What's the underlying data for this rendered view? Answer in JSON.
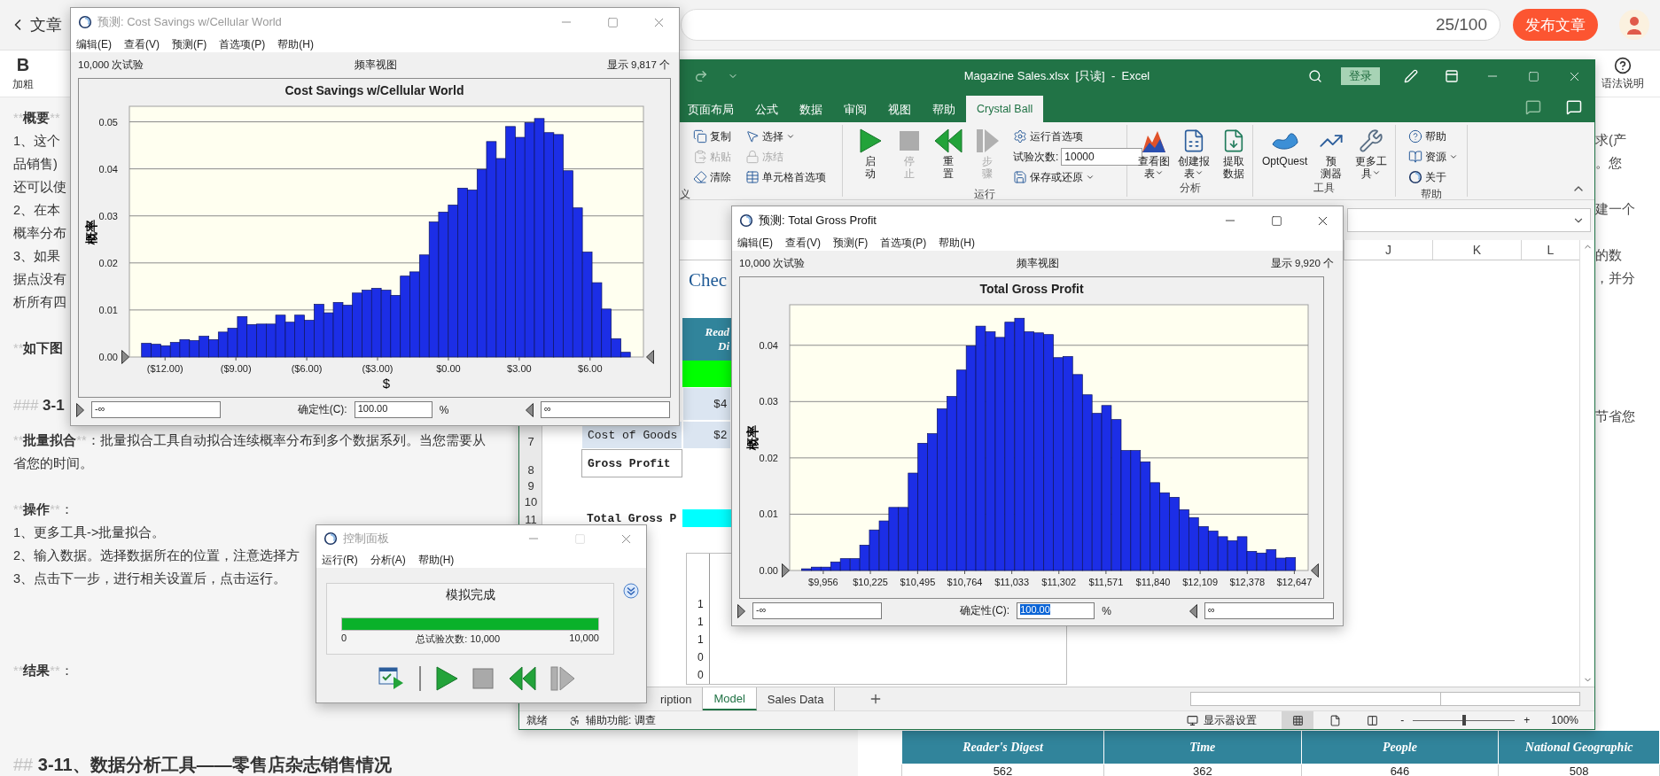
{
  "blog": {
    "back": "文章",
    "title_count": "25/100",
    "publish": "发布文章",
    "tools": [
      {
        "glyph": "B",
        "label": "加粗"
      }
    ],
    "help": "语法说明",
    "editor_lines": [
      {
        "kind": "text",
        "parts": [
          {
            "kind": "mark",
            "text": "**"
          },
          {
            "kind": "bold",
            "text": "概要"
          },
          {
            "kind": "mark",
            "text": "**"
          }
        ]
      },
      {
        "kind": "text",
        "parts": [
          {
            "kind": "plain",
            "text": "1、这个"
          }
        ]
      },
      {
        "kind": "text",
        "parts": [
          {
            "kind": "plain",
            "text": "品销售)"
          }
        ]
      },
      {
        "kind": "text",
        "parts": [
          {
            "kind": "plain",
            "text": "还可以使"
          }
        ]
      },
      {
        "kind": "text",
        "parts": [
          {
            "kind": "plain",
            "text": "2、在本"
          }
        ]
      },
      {
        "kind": "text",
        "parts": [
          {
            "kind": "plain",
            "text": "概率分布"
          }
        ]
      },
      {
        "kind": "text",
        "parts": [
          {
            "kind": "plain",
            "text": "3、如果"
          }
        ]
      },
      {
        "kind": "text",
        "parts": [
          {
            "kind": "plain",
            "text": "据点没有"
          }
        ]
      },
      {
        "kind": "text",
        "parts": [
          {
            "kind": "plain",
            "text": "析所有四"
          }
        ]
      },
      {
        "kind": "blank"
      },
      {
        "kind": "text",
        "parts": [
          {
            "kind": "mark",
            "text": "**"
          },
          {
            "kind": "bold",
            "text": "如下图"
          }
        ]
      },
      {
        "kind": "blank"
      },
      {
        "kind": "h3",
        "parts": [
          {
            "kind": "mark",
            "text": "### "
          },
          {
            "kind": "bold",
            "text": "3-1"
          }
        ]
      },
      {
        "kind": "text",
        "parts": [
          {
            "kind": "mark",
            "text": "**"
          },
          {
            "kind": "bold",
            "text": "批量拟合"
          },
          {
            "kind": "mark",
            "text": "**"
          },
          {
            "kind": "plain",
            "text": "：批量拟合工具自动拟合连续概率分布到多个数据系列。当您需要从"
          }
        ]
      },
      {
        "kind": "text",
        "parts": [
          {
            "kind": "plain",
            "text": "省您的时间。"
          }
        ]
      },
      {
        "kind": "blank"
      },
      {
        "kind": "text",
        "parts": [
          {
            "kind": "mark",
            "text": "**"
          },
          {
            "kind": "bold",
            "text": "操作"
          },
          {
            "kind": "mark",
            "text": "**"
          },
          {
            "kind": "plain",
            "text": "："
          }
        ]
      },
      {
        "kind": "text",
        "parts": [
          {
            "kind": "plain",
            "text": "1、更多工具->批量拟合。"
          }
        ]
      },
      {
        "kind": "text",
        "parts": [
          {
            "kind": "plain",
            "text": "2、输入数据。选择数据所在的位置，注意选择方"
          }
        ]
      },
      {
        "kind": "text",
        "parts": [
          {
            "kind": "plain",
            "text": "3、点击下一步，进行相关设置后，点击运行。"
          }
        ]
      },
      {
        "kind": "blank"
      },
      {
        "kind": "blank"
      },
      {
        "kind": "blank"
      },
      {
        "kind": "text",
        "parts": [
          {
            "kind": "mark",
            "text": "**"
          },
          {
            "kind": "bold",
            "text": "结果"
          },
          {
            "kind": "mark",
            "text": "**"
          },
          {
            "kind": "plain",
            "text": "："
          }
        ]
      },
      {
        "kind": "blank"
      },
      {
        "kind": "blank"
      },
      {
        "kind": "blank"
      },
      {
        "kind": "h2",
        "parts": [
          {
            "kind": "mark",
            "text": "## "
          },
          {
            "kind": "bold",
            "text": "3-11、数据分析工具——零售店杂志销售情况"
          }
        ]
      }
    ],
    "preview_lines": [
      {
        "kind": "text",
        "text": "求(产"
      },
      {
        "kind": "text",
        "text": "。您"
      },
      {
        "kind": "blank"
      },
      {
        "kind": "text",
        "text": "建一个"
      },
      {
        "kind": "blank"
      },
      {
        "kind": "text",
        "text": "的数"
      },
      {
        "kind": "text",
        "text": "，并分"
      },
      {
        "kind": "blank"
      },
      {
        "kind": "blank"
      },
      {
        "kind": "blank"
      },
      {
        "kind": "blank"
      },
      {
        "kind": "blank"
      },
      {
        "kind": "text",
        "text": "节省您"
      }
    ],
    "preview_table": {
      "columns": [
        "Reader's Digest",
        "Time",
        "People",
        "National Geographic"
      ],
      "rows": [
        [
          "562",
          "362",
          "646",
          "508"
        ]
      ]
    }
  },
  "excel": {
    "title": "Magazine Sales.xlsx  [只读]  -  Excel",
    "signin": "登录",
    "tabs": [
      {
        "label": "页面布局",
        "selected": false
      },
      {
        "label": "公式",
        "selected": false
      },
      {
        "label": "数据",
        "selected": false
      },
      {
        "label": "审阅",
        "selected": false
      },
      {
        "label": "视图",
        "selected": false
      },
      {
        "label": "帮助",
        "selected": false
      },
      {
        "label": "Crystal Ball",
        "selected": true
      }
    ],
    "ribbon": [
      {
        "label": "义",
        "items": [
          {
            "kind": "small",
            "label": [
              "复制"
            ],
            "disabled": false,
            "dropdown": false
          },
          {
            "kind": "small",
            "label": [
              "粘贴"
            ],
            "disabled": true,
            "dropdown": false
          },
          {
            "kind": "small",
            "label": [
              "清除"
            ],
            "disabled": false,
            "dropdown": false
          },
          {
            "kind": "small",
            "label": [
              "选择"
            ],
            "disabled": false,
            "dropdown": true
          },
          {
            "kind": "small",
            "label": [
              "冻结"
            ],
            "disabled": true,
            "dropdown": false
          },
          {
            "kind": "small",
            "label": [
              "单元格首选项"
            ],
            "disabled": false,
            "dropdown": false
          }
        ]
      },
      {
        "label": "运行",
        "items": [
          {
            "kind": "large",
            "label": [
              "启",
              "动"
            ],
            "disabled": false,
            "dropdown": false
          },
          {
            "kind": "large",
            "label": [
              "停",
              "止"
            ],
            "disabled": true,
            "dropdown": false
          },
          {
            "kind": "large",
            "label": [
              "重",
              "置"
            ],
            "disabled": false,
            "dropdown": false
          },
          {
            "kind": "large",
            "label": [
              "步",
              "骤"
            ],
            "disabled": true,
            "dropdown": false
          },
          {
            "kind": "small",
            "label": [
              "运行首选项"
            ],
            "disabled": false,
            "dropdown": false
          },
          {
            "kind": "field",
            "label": [
              "试验次数:"
            ],
            "value": "10000"
          },
          {
            "kind": "small",
            "label": [
              "保存或还原"
            ],
            "disabled": false,
            "dropdown": true
          }
        ]
      },
      {
        "label": "分析",
        "items": [
          {
            "kind": "large",
            "label": [
              "查看图",
              "表"
            ],
            "disabled": false,
            "dropdown": true
          },
          {
            "kind": "large",
            "label": [
              "创建报",
              "表"
            ],
            "disabled": false,
            "dropdown": true
          },
          {
            "kind": "large",
            "label": [
              "提取",
              "数据"
            ],
            "disabled": false,
            "dropdown": false
          }
        ]
      },
      {
        "label": "工具",
        "items": [
          {
            "kind": "large",
            "label": [
              "OptQuest"
            ],
            "disabled": false,
            "dropdown": false
          },
          {
            "kind": "large",
            "label": [
              "预",
              "测器"
            ],
            "disabled": false,
            "dropdown": false
          },
          {
            "kind": "large",
            "label": [
              "更多工",
              "具"
            ],
            "disabled": false,
            "dropdown": true
          }
        ]
      },
      {
        "label": "帮助",
        "items": [
          {
            "kind": "small",
            "label": [
              "帮助"
            ],
            "disabled": false,
            "dropdown": false
          },
          {
            "kind": "small",
            "label": [
              "资源"
            ],
            "disabled": false,
            "dropdown": true
          },
          {
            "kind": "small",
            "label": [
              "关于"
            ],
            "disabled": false,
            "dropdown": false
          }
        ]
      }
    ],
    "columns": [
      "J",
      "K",
      "L"
    ],
    "sheet": {
      "title": "Chec",
      "header_cell": [
        "Read",
        "Di"
      ],
      "value_cells": [
        "$4",
        "$2"
      ],
      "row_numbers": [
        "7",
        "8",
        "9",
        "10",
        "11"
      ],
      "labels": [
        "Cost of Goods",
        "Gross Profit",
        "Total Gross P"
      ],
      "chart_axis": [
        "1",
        "1",
        "1",
        "0",
        "0"
      ]
    },
    "sheet_tabs": [
      {
        "label": "ription",
        "selected": false
      },
      {
        "label": "Model",
        "selected": true
      },
      {
        "label": "Sales Data",
        "selected": false
      }
    ],
    "status": {
      "ready": "就绪",
      "accessibility": "辅助功能: 调查",
      "display": "显示器设置",
      "views": [
        {
          "selected": true
        },
        {
          "selected": false
        },
        {
          "selected": false
        }
      ],
      "zoom": {
        "minus": "-",
        "plus": "+",
        "level": 0.5,
        "reading": "100%"
      }
    }
  },
  "forecasts": [
    {
      "title": "预测: Cost Savings w/Cellular World",
      "active": false,
      "maximize_disabled": false,
      "menu": [
        "编辑(E)",
        "查看(V)",
        "预测(F)",
        "首选项(P)",
        "帮助(H)"
      ],
      "trials": "10,000 次试验",
      "view": "频率视图",
      "shown": "显示 9,817 个",
      "chart_data": {
        "type": "bar",
        "title": "Cost Savings w/Cellular World",
        "xlabel": "$",
        "ylabel": "概率",
        "x": [
          -12.79,
          -12.38,
          -11.98,
          -11.57,
          -11.17,
          -10.76,
          -10.35,
          -9.95,
          -9.54,
          -9.14,
          -8.73,
          -8.33,
          -7.92,
          -7.51,
          -7.11,
          -6.7,
          -6.3,
          -5.89,
          -5.48,
          -5.08,
          -4.67,
          -4.27,
          -3.86,
          -3.45,
          -3.05,
          -2.64,
          -2.24,
          -1.83,
          -1.43,
          -1.02,
          -0.61,
          -0.21,
          0.2,
          0.6,
          1.01,
          1.42,
          1.82,
          2.23,
          2.63,
          3.04,
          3.44,
          3.85,
          4.26,
          4.66,
          5.07,
          5.47,
          5.88,
          6.29,
          6.69,
          7.1,
          7.5
        ],
        "grid": true,
        "series": [
          {
            "color": "#1c2ee6",
            "values": [
              0.0029,
              0.0027,
              0.0024,
              0.0031,
              0.0037,
              0.0035,
              0.0044,
              0.0037,
              0.0053,
              0.0061,
              0.0086,
              0.0069,
              0.007,
              0.007,
              0.0089,
              0.0074,
              0.0089,
              0.0078,
              0.0112,
              0.0094,
              0.0116,
              0.011,
              0.0136,
              0.0142,
              0.0146,
              0.0142,
              0.0131,
              0.0172,
              0.0181,
              0.0217,
              0.0287,
              0.0308,
              0.0323,
              0.0359,
              0.0355,
              0.0399,
              0.0458,
              0.0422,
              0.049,
              0.0467,
              0.0498,
              0.0507,
              0.0477,
              0.0473,
              0.0396,
              0.0317,
              0.0223,
              0.0158,
              0.0102,
              0.0039,
              0.001
            ]
          }
        ],
        "xlim": [
          -13.51,
          8.26
        ],
        "ylim": [
          0,
          0.0533
        ],
        "xticks": [
          {
            "value": -12,
            "label": "($12.00)"
          },
          {
            "value": -9,
            "label": "($9.00)"
          },
          {
            "value": -6,
            "label": "($6.00)"
          },
          {
            "value": -3,
            "label": "($3.00)"
          },
          {
            "value": 0,
            "label": "$0.00"
          },
          {
            "value": 3,
            "label": "$3.00"
          },
          {
            "value": 6,
            "label": "$6.00"
          }
        ],
        "yticks": [
          {
            "value": 0,
            "label": "0.00"
          },
          {
            "value": 0.01,
            "label": "0.01"
          },
          {
            "value": 0.02,
            "label": "0.02"
          },
          {
            "value": 0.03,
            "label": "0.03"
          },
          {
            "value": 0.04,
            "label": "0.04"
          },
          {
            "value": 0.05,
            "label": "0.05"
          }
        ]
      },
      "lower": "-∞",
      "certainty_label": "确定性(C):",
      "certainty": "100.00",
      "certainty_selected": false,
      "percent": "%",
      "upper": "∞"
    },
    {
      "title": "预测: Total Gross Profit",
      "active": true,
      "maximize_disabled": false,
      "menu": [
        "编辑(E)",
        "查看(V)",
        "预测(F)",
        "首选项(P)",
        "帮助(H)"
      ],
      "trials": "10,000 次试验",
      "view": "频率视图",
      "shown": "显示 9,920 个",
      "chart_data": {
        "type": "bar",
        "title": "Total Gross Profit",
        "ylabel": "概率",
        "x": [
          9860,
          9915,
          9970,
          10026,
          10081,
          10137,
          10192,
          10247,
          10303,
          10358,
          10413,
          10469,
          10524,
          10579,
          10634,
          10690,
          10745,
          10800,
          10855,
          10911,
          10966,
          11021,
          11077,
          11132,
          11187,
          11243,
          11298,
          11353,
          11409,
          11464,
          11519,
          11574,
          11630,
          11685,
          11740,
          11796,
          11851,
          11906,
          11962,
          12017,
          12072,
          12128,
          12183,
          12238,
          12294,
          12349,
          12404,
          12460,
          12515,
          12570,
          12626
        ],
        "grid": true,
        "series": [
          {
            "color": "#1c2ee6",
            "values": [
              0.0003,
              0.0006,
              0.0006,
              0.0015,
              0.0021,
              0.0021,
              0.0045,
              0.0072,
              0.0088,
              0.0112,
              0.0112,
              0.0173,
              0.0226,
              0.0243,
              0.0287,
              0.0309,
              0.0356,
              0.0399,
              0.0434,
              0.0424,
              0.0414,
              0.0441,
              0.0448,
              0.0424,
              0.0422,
              0.0419,
              0.0378,
              0.038,
              0.0348,
              0.0312,
              0.0279,
              0.0293,
              0.0268,
              0.0213,
              0.0213,
              0.0193,
              0.0156,
              0.0138,
              0.013,
              0.0108,
              0.0094,
              0.0078,
              0.007,
              0.006,
              0.0053,
              0.006,
              0.0034,
              0.0031,
              0.0037,
              0.0022,
              0.0023
            ]
          }
        ],
        "xlim": [
          9764,
          12726
        ],
        "ylim": [
          0,
          0.0472
        ],
        "xticks": [
          {
            "value": 9956,
            "label": "$9,956"
          },
          {
            "value": 10225,
            "label": "$10,225"
          },
          {
            "value": 10495,
            "label": "$10,495"
          },
          {
            "value": 10764,
            "label": "$10,764"
          },
          {
            "value": 11033,
            "label": "$11,033"
          },
          {
            "value": 11302,
            "label": "$11,302"
          },
          {
            "value": 11571,
            "label": "$11,571"
          },
          {
            "value": 11840,
            "label": "$11,840"
          },
          {
            "value": 12109,
            "label": "$12,109"
          },
          {
            "value": 12378,
            "label": "$12,378"
          },
          {
            "value": 12647,
            "label": "$12,647"
          }
        ],
        "yticks": [
          {
            "value": 0,
            "label": "0.00"
          },
          {
            "value": 0.01,
            "label": "0.01"
          },
          {
            "value": 0.02,
            "label": "0.02"
          },
          {
            "value": 0.03,
            "label": "0.03"
          },
          {
            "value": 0.04,
            "label": "0.04"
          }
        ]
      },
      "lower": "-∞",
      "certainty_label": "确定性(C):",
      "certainty": "100.00",
      "certainty_selected": true,
      "percent": "%",
      "upper": "∞"
    }
  ],
  "control_panel": {
    "title": "控制面板",
    "active": false,
    "maximize_disabled": true,
    "menu": [
      "运行(R)",
      "分析(A)",
      "帮助(H)"
    ],
    "status": "模拟完成",
    "progress": {
      "level": 1,
      "min": "0",
      "label": "总试验次数: 10,000",
      "max": "10,000"
    },
    "buttons": [
      {
        "kind": "report",
        "disabled": false
      },
      {
        "kind": "divider",
        "disabled": false
      },
      {
        "kind": "run",
        "disabled": false
      },
      {
        "kind": "stop",
        "disabled": true
      },
      {
        "kind": "reset",
        "disabled": false
      },
      {
        "kind": "step",
        "disabled": true
      }
    ]
  }
}
